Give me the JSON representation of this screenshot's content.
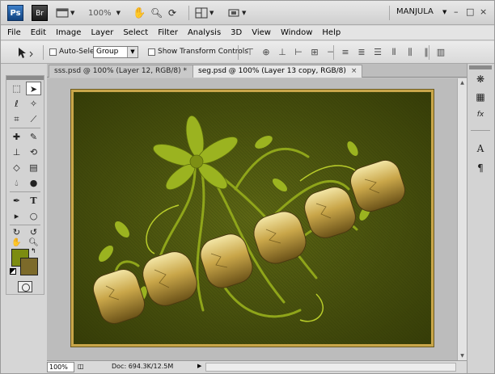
{
  "appbar": {
    "ps_logo": "Ps",
    "br_logo": "Br",
    "zoom_value": "100%",
    "workspace": "MANJULA",
    "win_minimize": "–",
    "win_restore": "□",
    "win_close": "×"
  },
  "menu": [
    "File",
    "Edit",
    "Image",
    "Layer",
    "Select",
    "Filter",
    "Analysis",
    "3D",
    "View",
    "Window",
    "Help"
  ],
  "options": {
    "auto_select_label": "Auto-Select:",
    "auto_select_value": "Group",
    "transform_label": "Show Transform Controls"
  },
  "tabs": [
    {
      "label": "sss.psd @ 100% (Layer 12, RGB/8) *",
      "close": "×"
    },
    {
      "label": "seg.psd @ 100% (Layer 13 copy, RGB/8)",
      "close": "×"
    }
  ],
  "status": {
    "zoom": "100%",
    "doc_info": "Doc: 694.3K/12.5M"
  },
  "right_panel": {
    "text_a": "A",
    "text_para": "¶",
    "fx": "fx"
  },
  "colors": {
    "foreground": "#7c8c10",
    "background": "#7c6a2a",
    "canvas_bg": "#49510f",
    "frame": "#c9a64a"
  }
}
